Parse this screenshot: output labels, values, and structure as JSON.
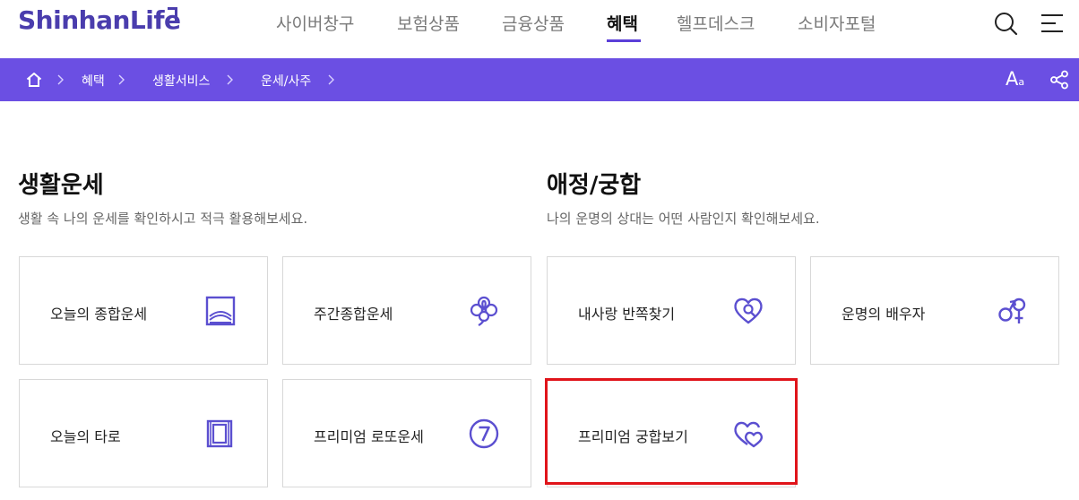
{
  "header": {
    "logo": "ShinhanLife",
    "nav": [
      {
        "label": "사이버창구",
        "active": false
      },
      {
        "label": "보험상품",
        "active": false
      },
      {
        "label": "금융상품",
        "active": false
      },
      {
        "label": "혜택",
        "active": true
      },
      {
        "label": "헬프데스크",
        "active": false
      },
      {
        "label": "소비자포털",
        "active": false
      }
    ],
    "icons": [
      "search-icon",
      "menu-icon"
    ]
  },
  "breadcrumb": {
    "items": [
      "혜택",
      "생활서비스",
      "운세/사주"
    ],
    "font_size_label": "A",
    "font_size_sub": "a",
    "icons": [
      "home-icon",
      "chevron-right-icon",
      "share-icon"
    ]
  },
  "sections": [
    {
      "title": "생활운세",
      "description": "생활 속 나의 운세를 확인하시고 적극 활용해보세요.",
      "cards": [
        {
          "label": "오늘의 종합운세",
          "icon": "landscape-frame-icon"
        },
        {
          "label": "주간종합운세",
          "icon": "clover-icon"
        },
        {
          "label": "오늘의 타로",
          "icon": "tarot-cards-icon"
        },
        {
          "label": "프리미엄 로또운세",
          "icon": "number-seven-icon"
        }
      ]
    },
    {
      "title": "애정/궁합",
      "description": "나의 운명의 상대는 어떤 사람인지 확인해보세요.",
      "cards": [
        {
          "label": "내사랑 반쪽찾기",
          "icon": "heart-search-icon"
        },
        {
          "label": "운명의 배우자",
          "icon": "gender-symbols-icon"
        },
        {
          "label": "프리미엄 궁합보기",
          "icon": "double-heart-icon"
        }
      ]
    }
  ],
  "colors": {
    "brand": "#4a3dad",
    "breadcrumb_bg": "#6b4fe3",
    "icon": "#5b4fd0",
    "highlight": "#e0141a"
  }
}
